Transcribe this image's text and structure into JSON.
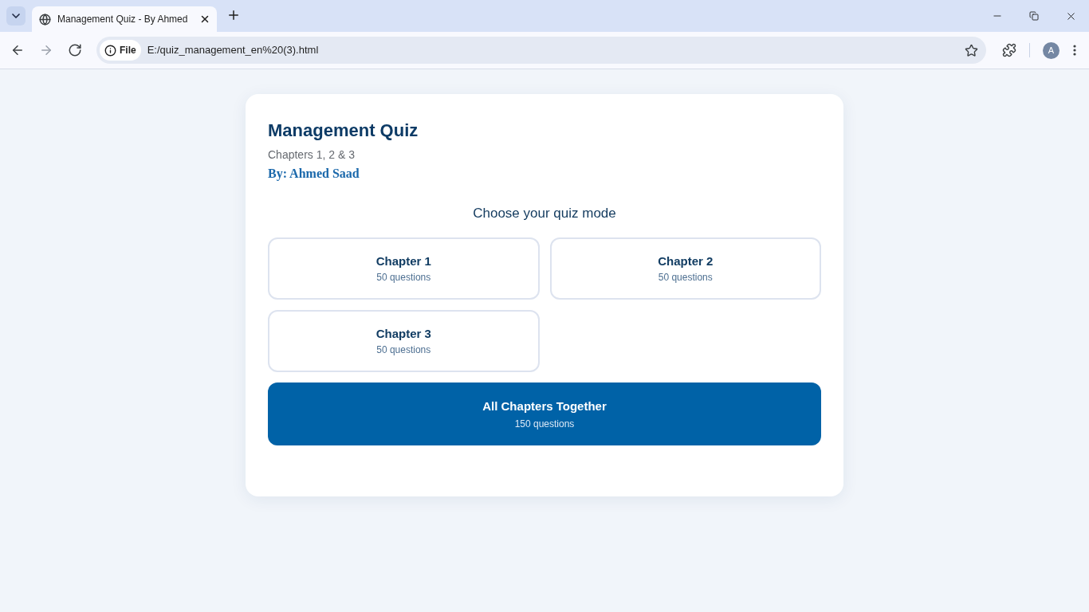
{
  "browser": {
    "tab": {
      "title": "Management Quiz - By Ahmed"
    },
    "address_bar": {
      "scheme_chip": "File",
      "url": "E:/quiz_management_en%20(3).html"
    },
    "profile": {
      "initial": "A"
    }
  },
  "quiz": {
    "title": "Management Quiz",
    "subtitle": "Chapters 1, 2 & 3",
    "author": "By: Ahmed Saad",
    "prompt": "Choose your quiz mode",
    "modes": [
      {
        "kind": "chapter",
        "title": "Chapter 1",
        "count": "50 questions"
      },
      {
        "kind": "chapter",
        "title": "Chapter 2",
        "count": "50 questions"
      },
      {
        "kind": "chapter",
        "title": "Chapter 3",
        "count": "50 questions"
      },
      {
        "kind": "all",
        "title": "All Chapters Together",
        "count": "150 questions"
      }
    ]
  }
}
